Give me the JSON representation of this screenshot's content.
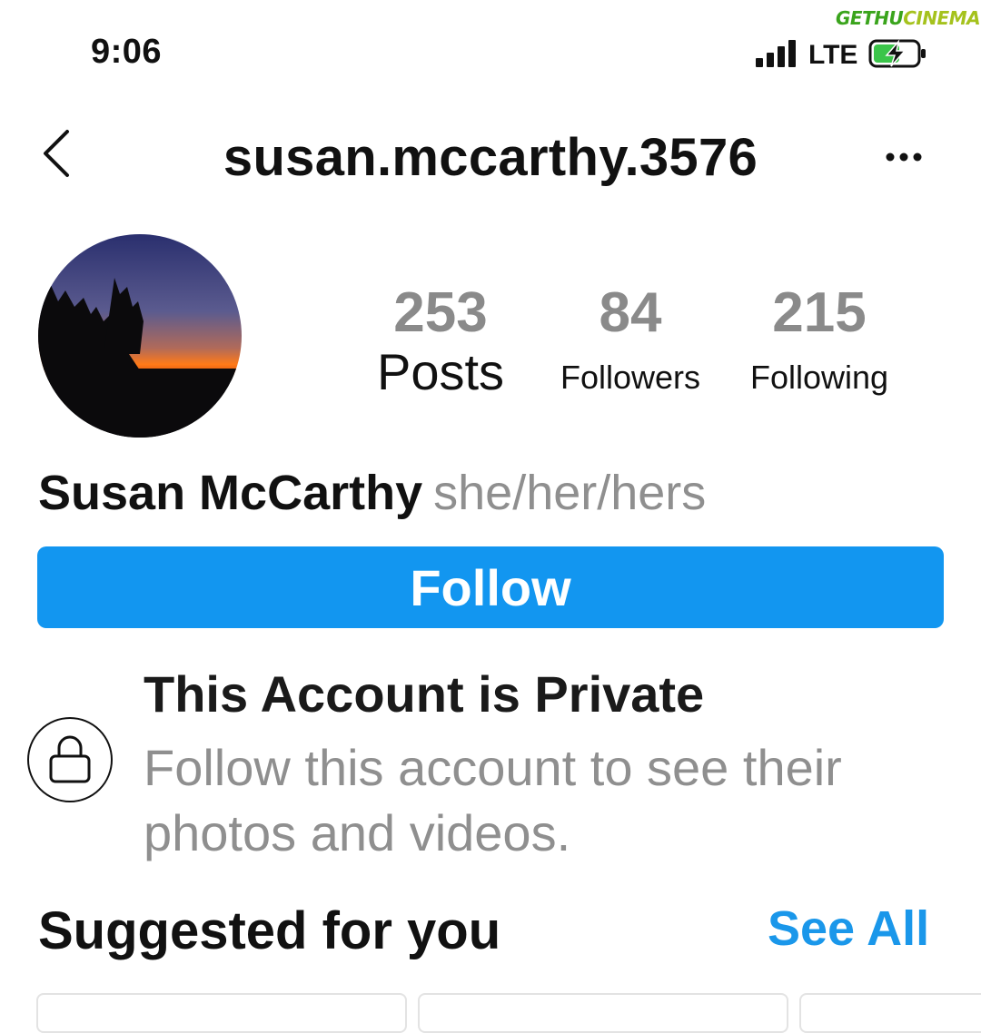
{
  "status_bar": {
    "time": "9:06",
    "carrier": "LTE"
  },
  "watermark": {
    "part1": "GETHU",
    "part2": "CINEMA"
  },
  "header": {
    "username": "susan.mccarthy.3576",
    "back_icon": "chevron-left-icon",
    "more_icon": "ellipsis-icon"
  },
  "profile": {
    "full_name": "Susan McCarthy",
    "pronouns": "she/her/hers",
    "stats": {
      "posts": {
        "value": "253",
        "label": "Posts"
      },
      "followers": {
        "value": "84",
        "label": "Followers"
      },
      "following": {
        "value": "215",
        "label": "Following"
      }
    }
  },
  "actions": {
    "follow_label": "Follow"
  },
  "private_notice": {
    "title": "This Account is Private",
    "description": "Follow this account to see their photos and videos."
  },
  "suggested": {
    "title": "Suggested for you",
    "see_all_label": "See All"
  },
  "colors": {
    "accent": "#1296f0",
    "link": "#1a97ea",
    "muted": "#8f8f8f"
  }
}
